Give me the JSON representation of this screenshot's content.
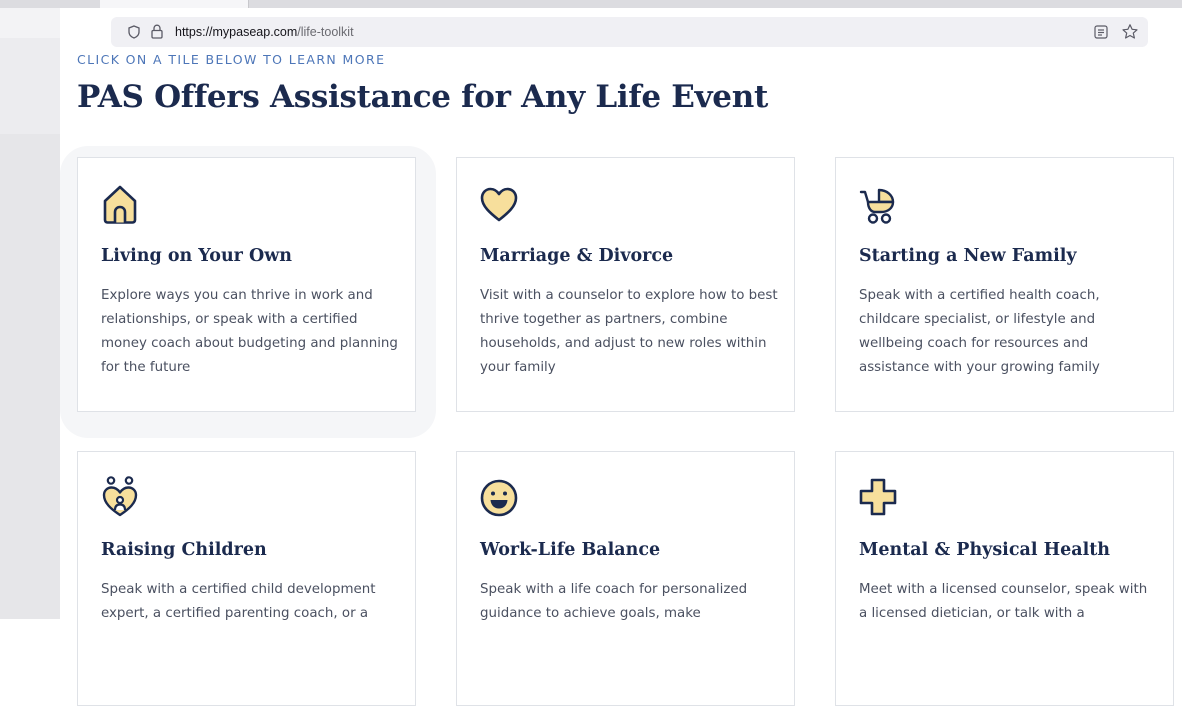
{
  "browser": {
    "url_host": "https://mypaseap.com",
    "url_path": "/life-toolkit",
    "icons": {
      "tracking": "shield-icon",
      "security": "lock-icon",
      "reader": "reader-view-icon",
      "bookmark": "star-icon"
    }
  },
  "section": {
    "eyebrow": "CLICK ON A TILE BELOW TO LEARN MORE",
    "title": "PAS Offers Assistance for Any Life Event"
  },
  "colors": {
    "accent_blue": "#4d76b8",
    "navy": "#1b2a4e",
    "icon_fill": "#f7df9c",
    "body_text": "#4a5060"
  },
  "tiles": [
    {
      "icon": "house-icon",
      "title": "Living on Your Own",
      "description": "Explore ways you can thrive in work and relationships, or speak with a certified money coach about budgeting and planning for the future"
    },
    {
      "icon": "heart-icon",
      "title": "Marriage & Divorce",
      "description": "Visit with a counselor to explore how to best thrive together as partners, combine households, and adjust to new roles within your family"
    },
    {
      "icon": "stroller-icon",
      "title": "Starting a New Family",
      "description": "Speak with a certified health coach, childcare specialist, or lifestyle and wellbeing coach for resources and assistance with your growing family"
    },
    {
      "icon": "family-heart-icon",
      "title": "Raising Children",
      "description": "Speak with a certified child development expert, a certified parenting coach, or a"
    },
    {
      "icon": "smiley-icon",
      "title": "Work-Life Balance",
      "description": "Speak with a life coach for personalized guidance to achieve goals, make"
    },
    {
      "icon": "medical-cross-icon",
      "title": "Mental & Physical Health",
      "description": "Meet with a licensed counselor, speak with a licensed dietician, or talk with a"
    }
  ]
}
